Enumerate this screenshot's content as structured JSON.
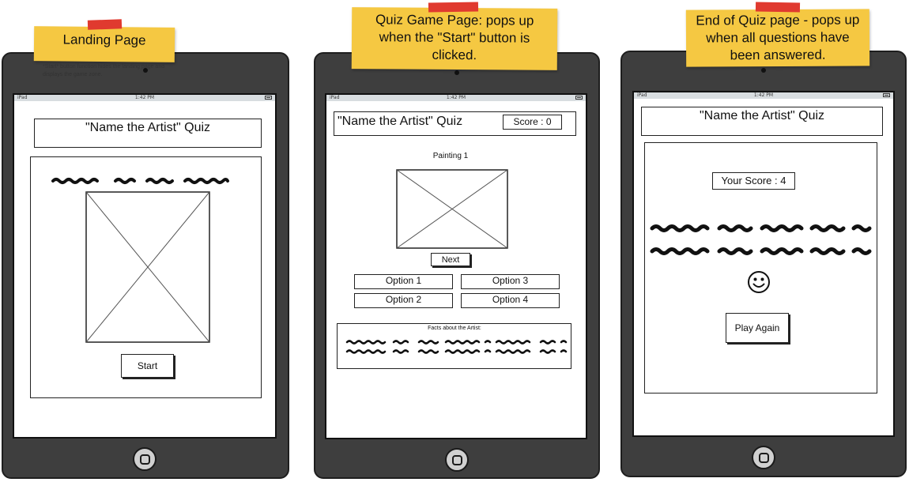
{
  "landing": {
    "note": "Landing Page",
    "annotation": "*Start* button function hides the landing page and displays the game zone.",
    "status": {
      "device": "iPad",
      "time": "1:42 PM"
    },
    "quiz_title": "\"Name the Artist\" Quiz",
    "start_label": "Start"
  },
  "game": {
    "note": "Quiz Game Page: pops up when the \"Start\" button is clicked.",
    "status": {
      "device": "iPad",
      "time": "1:42 PM"
    },
    "quiz_title": "\"Name the Artist\" Quiz",
    "score_label": "Score : 0",
    "painting_label": "Painting 1",
    "next_label": "Next",
    "options": [
      "Option 1",
      "Option 2",
      "Option 3",
      "Option 4"
    ],
    "facts_title": "Facts about the Artist:"
  },
  "end": {
    "note": "End of Quiz page - pops up when all questions have been answered.",
    "status": {
      "device": "iPad",
      "time": "1:42 PM"
    },
    "quiz_title": "\"Name the Artist\" Quiz",
    "your_score_label": "Your Score : 4",
    "play_again_label": "Play Again"
  }
}
